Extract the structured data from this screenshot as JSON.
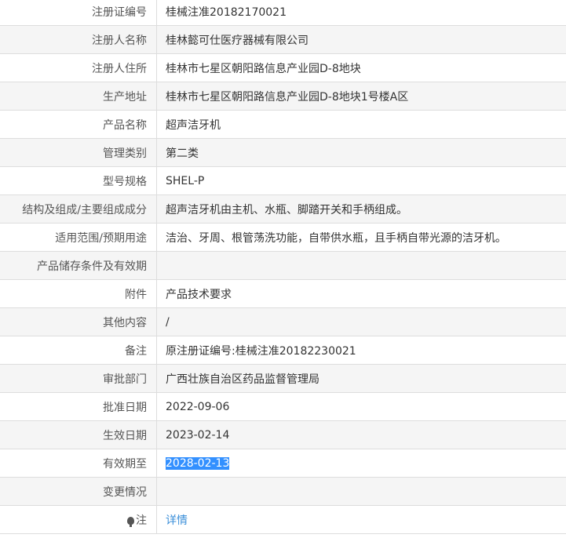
{
  "rows": [
    {
      "label": "注册证编号",
      "value": "桂械注准20182170021"
    },
    {
      "label": "注册人名称",
      "value": "桂林懿可仕医疗器械有限公司"
    },
    {
      "label": "注册人住所",
      "value": "桂林市七星区朝阳路信息产业园D-8地块"
    },
    {
      "label": "生产地址",
      "value": "桂林市七星区朝阳路信息产业园D-8地块1号楼A区"
    },
    {
      "label": "产品名称",
      "value": "超声洁牙机"
    },
    {
      "label": "管理类别",
      "value": "第二类"
    },
    {
      "label": "型号规格",
      "value": "SHEL-P"
    },
    {
      "label": "结构及组成/主要组成成分",
      "value": "超声洁牙机由主机、水瓶、脚踏开关和手柄组成。"
    },
    {
      "label": "适用范围/预期用途",
      "value": "洁治、牙周、根管荡洗功能，自带供水瓶，且手柄自带光源的洁牙机。"
    },
    {
      "label": "产品储存条件及有效期",
      "value": ""
    },
    {
      "label": "附件",
      "value": "产品技术要求"
    },
    {
      "label": "其他内容",
      "value": "/"
    },
    {
      "label": "备注",
      "value": "原注册证编号:桂械注准20182230021"
    },
    {
      "label": "审批部门",
      "value": "广西壮族自治区药品监督管理局"
    },
    {
      "label": "批准日期",
      "value": "2022-09-06"
    },
    {
      "label": "生效日期",
      "value": "2023-02-14"
    },
    {
      "label": "有效期至",
      "value": "2028-02-13"
    },
    {
      "label": "变更情况",
      "value": ""
    }
  ],
  "note": {
    "label": "注",
    "link": "详情",
    "icon": "lightbulb-icon"
  }
}
